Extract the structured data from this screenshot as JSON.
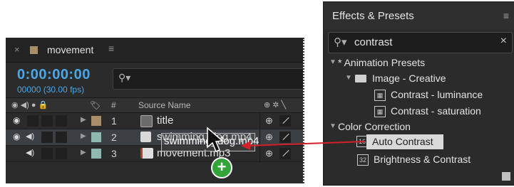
{
  "timeline": {
    "close": "×",
    "comp_name": "movement",
    "menu": "≡",
    "timecode": "0:00:00:00",
    "fps": "00000 (30.00 fps)",
    "columns": {
      "num": "#",
      "source_name": "Source Name"
    },
    "layers": [
      {
        "num": "1",
        "name": "title",
        "label_color": "#a88f6a"
      },
      {
        "num": "2",
        "name": "swimming_dog.mp4",
        "label_color": "#8fb8b0"
      },
      {
        "num": "3",
        "name": "movement.mp3",
        "label_color": "#8fb8b0"
      }
    ],
    "drag_label": "swimming_dog.mp4"
  },
  "effects": {
    "title": "Effects & Presets",
    "menu": "≡",
    "search_value": "contrast",
    "clear": "×",
    "tree": {
      "animation_presets": "* Animation Presets",
      "image_creative": "Image - Creative",
      "contrast_luminance": "Contrast - luminance",
      "contrast_saturation": "Contrast - saturation",
      "color_correction": "Color Correction",
      "auto_contrast": "Auto Contrast",
      "brightness_contrast": "Brightness & Contrast"
    }
  },
  "colors": {
    "accent_blue": "#4aa7e8",
    "arrow_red": "#d4202a",
    "add_green": "#33a33a"
  }
}
